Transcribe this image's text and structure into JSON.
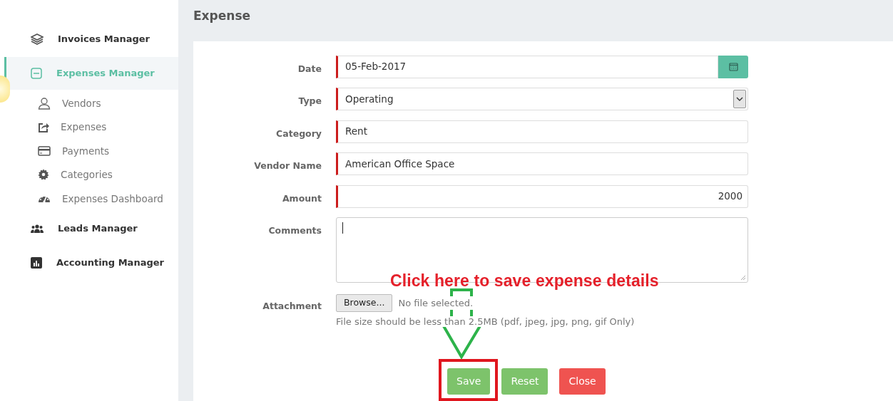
{
  "sidebar": {
    "items": [
      {
        "label": "Invoices Manager",
        "selected": false,
        "expanded": false
      },
      {
        "label": "Expenses Manager",
        "selected": true,
        "expanded": true,
        "children": [
          {
            "label": "Vendors"
          },
          {
            "label": "Expenses"
          },
          {
            "label": "Payments"
          },
          {
            "label": "Categories"
          },
          {
            "label": "Expenses Dashboard"
          }
        ]
      },
      {
        "label": "Leads Manager",
        "selected": false,
        "expanded": false
      },
      {
        "label": "Accounting Manager",
        "selected": false,
        "expanded": false
      }
    ]
  },
  "page_title": "Expense",
  "form": {
    "fields": [
      {
        "kind": "date",
        "label": "Date",
        "value": "05-Feb-2017",
        "required": true
      },
      {
        "kind": "select",
        "label": "Type",
        "value": "Operating",
        "required": true
      },
      {
        "kind": "text",
        "label": "Category",
        "value": "Rent",
        "required": true
      },
      {
        "kind": "text",
        "label": "Vendor Name",
        "value": "American Office Space",
        "required": true
      },
      {
        "kind": "number",
        "label": "Amount",
        "value": "2000",
        "required": true
      },
      {
        "kind": "textarea",
        "label": "Comments",
        "required": false
      },
      {
        "kind": "file",
        "label": "Attachment",
        "button": "Browse...",
        "status": "No file selected.",
        "hint": "File size should be less than 2.5MB (pdf, jpeg, jpg, png, gif Only)"
      }
    ],
    "buttons": [
      {
        "label": "Save",
        "kind": "success"
      },
      {
        "label": "Reset",
        "kind": "success"
      },
      {
        "label": "Close",
        "kind": "danger"
      }
    ]
  },
  "annotation": {
    "text": "Click here to save expense details"
  }
}
